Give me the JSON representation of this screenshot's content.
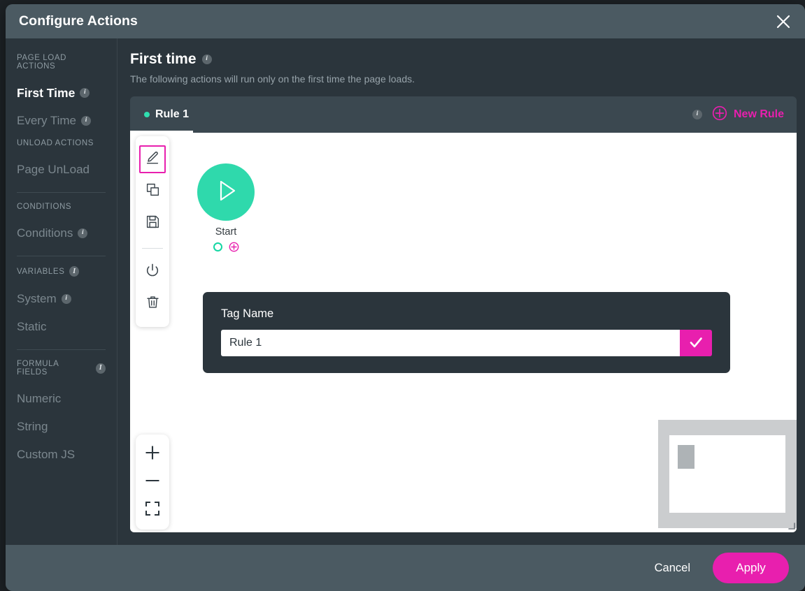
{
  "window": {
    "title": "Configure Actions",
    "close_icon": "close-icon"
  },
  "sidebar": {
    "groups": [
      {
        "label": "PAGE LOAD ACTIONS",
        "has_info": false,
        "items": [
          {
            "label": "First Time",
            "active": true,
            "has_info": true
          },
          {
            "label": "Every Time",
            "active": false,
            "has_info": true
          }
        ]
      },
      {
        "label": "UNLOAD ACTIONS",
        "has_info": false,
        "items": [
          {
            "label": "Page UnLoad",
            "active": false,
            "has_info": false
          }
        ]
      },
      {
        "label": "CONDITIONS",
        "has_info": false,
        "items": [
          {
            "label": "Conditions",
            "active": false,
            "has_info": true
          }
        ]
      },
      {
        "label": "VARIABLES",
        "has_info": true,
        "items": [
          {
            "label": "System",
            "active": false,
            "has_info": true
          },
          {
            "label": "Static",
            "active": false,
            "has_info": false
          }
        ]
      },
      {
        "label": "FORMULA FIELDS",
        "has_info": true,
        "items": [
          {
            "label": "Numeric",
            "active": false,
            "has_info": false
          },
          {
            "label": "String",
            "active": false,
            "has_info": false
          },
          {
            "label": "Custom JS",
            "active": false,
            "has_info": false
          }
        ]
      }
    ],
    "info_glyph": "i"
  },
  "main": {
    "page_title": "First time",
    "page_title_info": "i",
    "page_subtitle": "The following actions will run only on the first time the page loads.",
    "tabs": [
      {
        "label": "Rule 1",
        "active": true,
        "status_color": "#2fdfb0"
      }
    ],
    "tabbar_info": "i",
    "new_rule_label": "New Rule",
    "new_rule_icon": "plus-circle-icon"
  },
  "canvas": {
    "toolbar": [
      {
        "name": "edit-tool",
        "icon": "pencil-icon",
        "selected": true
      },
      {
        "name": "duplicate-tool",
        "icon": "copy-icon",
        "selected": false
      },
      {
        "name": "save-tool",
        "icon": "floppy-disk-icon",
        "selected": false
      },
      {
        "name": "disable-tool",
        "icon": "power-icon",
        "selected": false
      },
      {
        "name": "delete-tool",
        "icon": "trash-icon",
        "selected": false
      }
    ],
    "zoom_controls": [
      {
        "name": "zoom-in-button",
        "icon": "plus-icon"
      },
      {
        "name": "zoom-out-button",
        "icon": "minus-icon"
      },
      {
        "name": "fit-to-screen-button",
        "icon": "fit-screen-icon"
      }
    ],
    "start_node": {
      "label": "Start",
      "icon": "play-icon",
      "color": "#2fd9ac",
      "out_port_icon": "connector-circle-icon",
      "add_port_icon": "plus-circle-icon"
    },
    "tag_panel": {
      "label": "Tag Name",
      "value": "Rule 1",
      "placeholder": "Tag Name",
      "confirm_icon": "check-icon",
      "confirm_color": "#e81fae"
    },
    "minimap": {
      "name": "minimap"
    }
  },
  "footer": {
    "cancel_label": "Cancel",
    "apply_label": "Apply",
    "apply_color": "#e81fae"
  }
}
